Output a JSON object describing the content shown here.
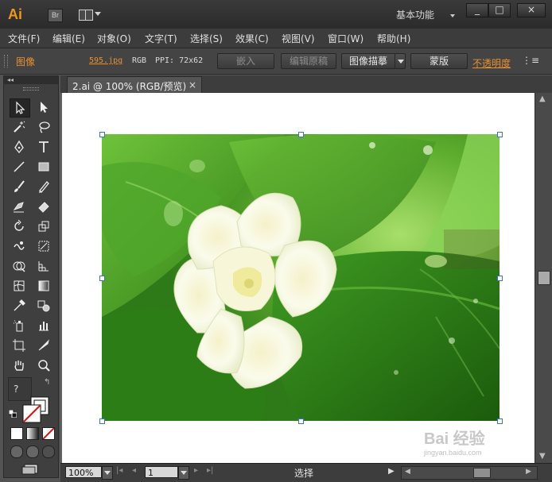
{
  "titlebar": {
    "logo": "Ai",
    "bridge_label": "Br",
    "workspace_label": "基本功能",
    "minimize": "_",
    "maximize": "□",
    "close": "×"
  },
  "menu": [
    {
      "label": "文件(F)"
    },
    {
      "label": "编辑(E)"
    },
    {
      "label": "对象(O)"
    },
    {
      "label": "文字(T)"
    },
    {
      "label": "选择(S)"
    },
    {
      "label": "效果(C)"
    },
    {
      "label": "视图(V)"
    },
    {
      "label": "窗口(W)"
    },
    {
      "label": "帮助(H)"
    }
  ],
  "control": {
    "object_type": "图像",
    "file_name": "595.jpg",
    "color_mode": "RGB",
    "ppi": "PPI: 72x62",
    "embed_label": "嵌入",
    "edit_original_label": "编辑原稿",
    "image_trace_label": "图像描摹",
    "mask_label": "蒙版",
    "opacity_label": "不透明度",
    "panel_menu": "⋮≡"
  },
  "tools": {
    "help_label": "?",
    "swap_label": "↰",
    "collapse_label": "◂◂"
  },
  "document": {
    "tab_label": "2.ai @ 100% (RGB/预览)",
    "tab_close": "×"
  },
  "status": {
    "zoom_value": "100%",
    "page_value": "1",
    "first": "|◂",
    "prev": "◂",
    "next": "▸",
    "last": "▸|",
    "status_text": "选择",
    "status_arrow": "▶"
  },
  "watermark": {
    "brand": "Bai 经验",
    "url": "jingyan.baidu.com"
  },
  "colors": {
    "accent_orange": "#e8912f",
    "selection_blue": "#3a73c9",
    "panel_bg": "#535353"
  }
}
